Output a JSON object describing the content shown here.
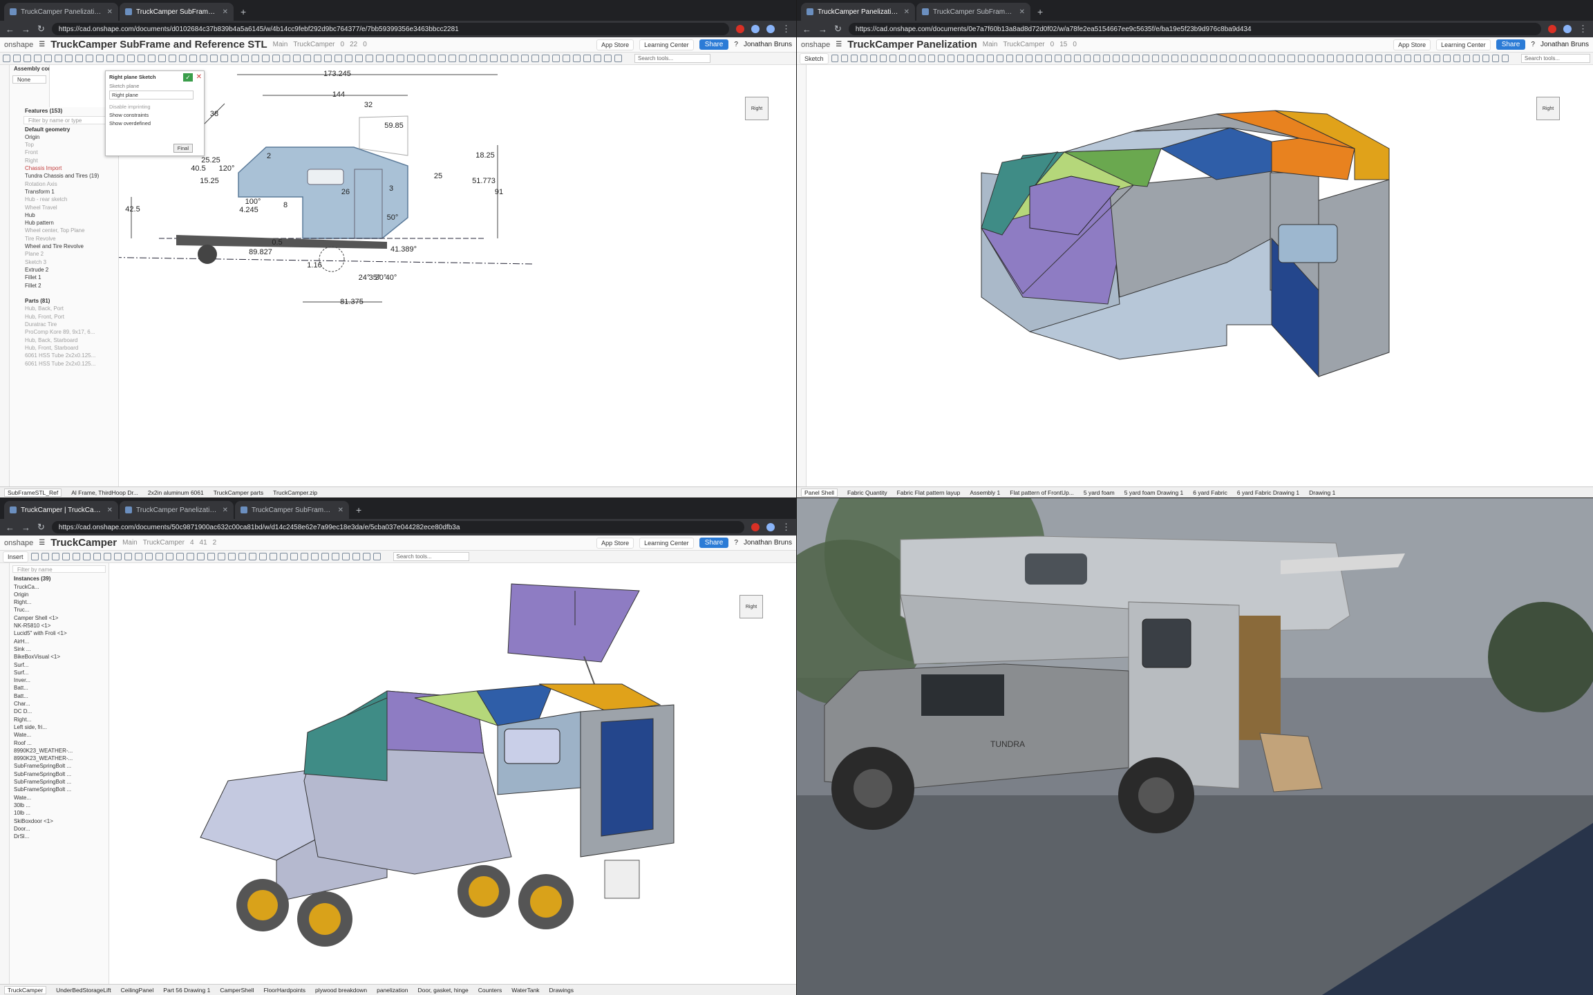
{
  "q1": {
    "tabs": [
      {
        "label": "TruckCamper Panelization | Pr"
      },
      {
        "label": "TruckCamper SubFrame and R"
      }
    ],
    "url": "https://cad.onshape.com/documents/d0102684c37b839b4a5a6145/w/4b14cc9febf292d9bc764377/e/7bb59399356e3463bbcc2281",
    "app": "onshape",
    "title": "TruckCamper SubFrame and Reference STL",
    "branch": "Main",
    "folder": "TruckCamper",
    "counts": [
      "0",
      "22",
      "0"
    ],
    "buttons": {
      "app_store": "App Store",
      "learning": "Learning Center",
      "share": "Share",
      "user": "Jonathan Bruns",
      "search_tools": "Search tools..."
    },
    "assembly": {
      "title": "Assembly contexts",
      "value": "None"
    },
    "features_header": "Features (153)",
    "filter_placeholder": "Filter by name or type",
    "features": [
      {
        "t": "Default geometry",
        "c": "hdr"
      },
      {
        "t": "Origin",
        "c": ""
      },
      {
        "t": "Top",
        "c": "dim"
      },
      {
        "t": "Front",
        "c": "dim"
      },
      {
        "t": "Right",
        "c": "dim"
      },
      {
        "t": "Chassis Import",
        "c": "red"
      },
      {
        "t": "Tundra Chassis and Tires (19)",
        "c": ""
      },
      {
        "t": "Rotation Axis",
        "c": "dim"
      },
      {
        "t": "Transform 1",
        "c": ""
      },
      {
        "t": "Hub - rear sketch",
        "c": "dim"
      },
      {
        "t": "Wheel Travel",
        "c": "dim"
      },
      {
        "t": "Hub",
        "c": ""
      },
      {
        "t": "Hub pattern",
        "c": ""
      },
      {
        "t": "Wheel center, Top Plane",
        "c": "dim"
      },
      {
        "t": "Tire Revolve",
        "c": "dim"
      },
      {
        "t": "Wheel and Tire Revolve",
        "c": ""
      },
      {
        "t": "Plane 2",
        "c": "dim"
      },
      {
        "t": "Sketch 3",
        "c": "dim"
      },
      {
        "t": "Extrude 2",
        "c": ""
      },
      {
        "t": "Fillet 1",
        "c": ""
      },
      {
        "t": "Fillet 2",
        "c": ""
      },
      {
        "t": "",
        "c": ""
      },
      {
        "t": "Parts (81)",
        "c": "hdr"
      },
      {
        "t": "Hub, Back, Port",
        "c": "dim"
      },
      {
        "t": "Hub, Front, Port",
        "c": "dim"
      },
      {
        "t": "Duratrac Tire",
        "c": "dim"
      },
      {
        "t": "ProComp Kore 89, 9x17, 6...",
        "c": "dim"
      },
      {
        "t": "Hub, Back, Starboard",
        "c": "dim"
      },
      {
        "t": "Hub, Front, Starboard",
        "c": "dim"
      },
      {
        "t": "6061 HSS Tube 2x2x0.125...",
        "c": "dim"
      },
      {
        "t": "6061 HSS Tube 2x2x0.125...",
        "c": "dim"
      }
    ],
    "sketch": {
      "title": "Right plane Sketch",
      "plane_label": "Sketch plane",
      "plane": "Right plane",
      "opt1": "Disable imprinting",
      "opt2": "Show constraints",
      "opt3": "Show overdefined",
      "final": "Final"
    },
    "dims": [
      "173.245",
      "144",
      "32",
      "38",
      "59.85",
      "25.25",
      "2",
      "18.25",
      "40.5",
      "120°",
      "15.25",
      "25",
      "3",
      "26",
      "51.773",
      "91",
      "42.5",
      "100°",
      "8",
      "4.245",
      "50°",
      "0.5",
      "89.827",
      "41.389°",
      "1.16",
      "24°",
      "35°",
      "30°",
      "40°",
      "81.375"
    ],
    "cube": "Right",
    "bottom_tabs": [
      "SubFrameSTL_Ref",
      "Al Frame, ThirdHoop Dr...",
      "2x2in aluminum 6061",
      "TruckCamper parts",
      "TruckCamper.zip"
    ]
  },
  "q2": {
    "tabs": [
      {
        "label": "TruckCamper Panelization | Pr"
      },
      {
        "label": "TruckCamper SubFrame and R"
      }
    ],
    "url": "https://cad.onshape.com/documents/0e7a7f60b13a8ad8d72d0f02/w/a78fe2ea5154667ee9c5635f/e/ba19e5f23b9d976c8ba9d434",
    "app": "onshape",
    "title": "TruckCamper Panelization",
    "branch": "Main",
    "folder": "TruckCamper",
    "counts": [
      "0",
      "15",
      "0"
    ],
    "buttons": {
      "app_store": "App Store",
      "learning": "Learning Center",
      "share": "Share",
      "user": "Jonathan Bruns",
      "search_tools": "Search tools...",
      "sketch": "Sketch"
    },
    "cube": "Right",
    "bottom_tabs": [
      "Panel Shell",
      "Fabric Quantity",
      "Fabric Flat pattern layup",
      "Assembly 1",
      "Flat pattern of FrontUp...",
      "5 yard foam",
      "5 yard foam Drawing 1",
      "6 yard Fabric",
      "6 yard Fabric Drawing 1",
      "Drawing 1"
    ]
  },
  "q3": {
    "tabs": [
      {
        "label": "TruckCamper | TruckCamper"
      },
      {
        "label": "TruckCamper Panelization | Pr"
      },
      {
        "label": "TruckCamper SubFrame and R"
      }
    ],
    "url": "https://cad.onshape.com/documents/50c9871900ac632c00ca81bd/w/d14c2458e62e7a99ec18e3da/e/5cba037e044282ece80dfb3a",
    "app": "onshape",
    "title": "TruckCamper",
    "branch": "Main",
    "folder": "TruckCamper",
    "counts": [
      "4",
      "41",
      "2"
    ],
    "buttons": {
      "app_store": "App Store",
      "learning": "Learning Center",
      "share": "Share",
      "user": "Jonathan Bruns",
      "search_tools": "Search tools...",
      "insert": "Insert"
    },
    "filter_placeholder": "Filter by name",
    "instances_header": "Instances (39)",
    "instances": [
      "TruckCa...",
      "Origin",
      "Right...",
      "Truc...",
      "Camper Shell <1>",
      "NK-R5810 <1>",
      "Lucid5\" with Froli <1>",
      "AirH...",
      "Sink ...",
      "BikeBoxVisual <1>",
      "Surf...",
      "Surf...",
      "Inver...",
      "Batt...",
      "Batt...",
      "Char...",
      "DC D...",
      "Right...",
      "Left side, fri...",
      "Wate...",
      "Roof ...",
      "8990K23_WEATHER-...",
      "8990K23_WEATHER-...",
      "SubFrameSpringBolt ...",
      "SubFrameSpringBolt ...",
      "SubFrameSpringBolt ...",
      "SubFrameSpringBolt ...",
      "Wate...",
      "30lb ...",
      "10lb ...",
      "SkiBoxdoor <1>",
      "Door...",
      "DrSl..."
    ],
    "cube": "Right",
    "bottom_tabs": [
      "TruckCamper",
      "UnderBedStorageLift",
      "CeilingPanel",
      "Part 56 Drawing 1",
      "CamperShell",
      "FloorHardpoints",
      "plywood breakdown",
      "panelization",
      "Door, gasket, hinge",
      "Counters",
      "WaterTank",
      "Drawings"
    ]
  },
  "q4": {
    "photo_text": "TUNDRA"
  },
  "colors": {
    "teal": "#3f8c86",
    "green": "#6aa84f",
    "lightgreen": "#b5d77a",
    "blue": "#2f5ea8",
    "lightblue": "#b7c7d8",
    "orange": "#e8821f",
    "gold": "#e0a21a",
    "purple": "#8e7cc3",
    "gray": "#9da3aa",
    "navy": "#24468c",
    "share": "#2b7bd6"
  }
}
